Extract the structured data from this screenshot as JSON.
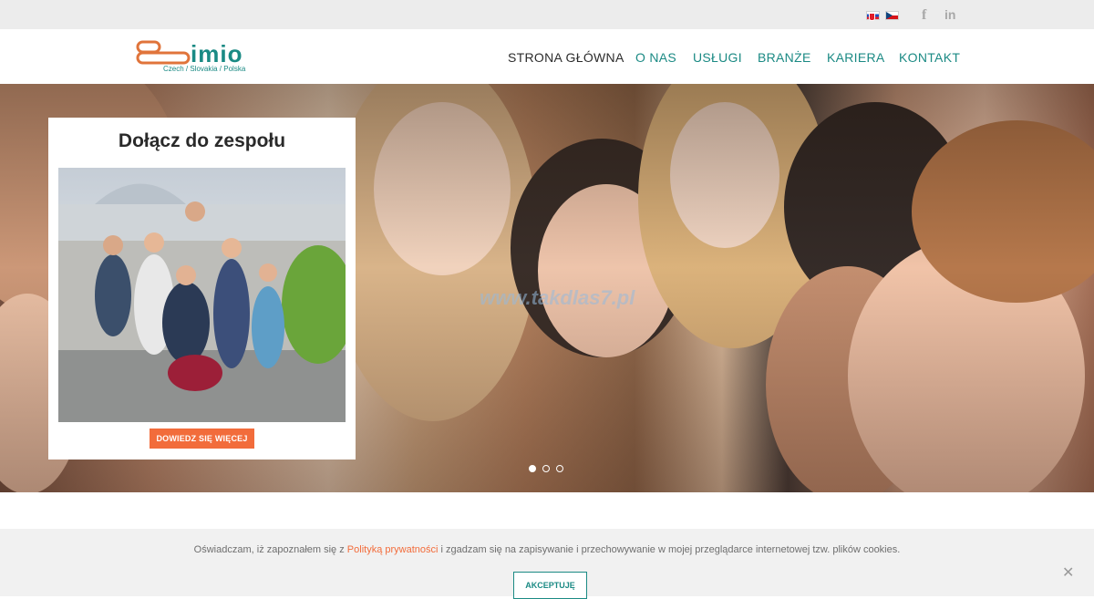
{
  "topbar": {
    "flags": [
      {
        "name": "slovakia-flag-icon"
      },
      {
        "name": "czech-flag-icon"
      }
    ],
    "social": {
      "facebook": "f",
      "linkedin": "in"
    }
  },
  "header": {
    "logo": {
      "word": "imio",
      "tagline": "Czech / Slovakia / Polska",
      "brand_teal": "#1a8a84",
      "brand_orange": "#e0743b"
    },
    "nav": [
      {
        "label": "STRONA GŁÓWNA",
        "active": true
      },
      {
        "label": "O NAS",
        "active": false
      },
      {
        "label": "USŁUGI",
        "active": false
      },
      {
        "label": "BRANŻE",
        "active": false
      },
      {
        "label": "KARIERA",
        "active": false
      },
      {
        "label": "KONTAKT",
        "active": false
      }
    ]
  },
  "hero": {
    "watermark": "www.takdlas7.pl",
    "slider": {
      "total": 3,
      "active_index": 0
    },
    "card": {
      "title": "Dołącz do zespołu",
      "button": "DOWIEDZ SIĘ WIĘCEJ"
    }
  },
  "cookie": {
    "text_before": "Oświadczam, iż zapoznałem się z ",
    "link": "Polityką prywatności",
    "text_after": " i zgadzam się na zapisywanie i przechowywanie w mojej przeglądarce internetowej tzw. plików cookies.",
    "accept": "AKCEPTUJĘ",
    "close_icon": "close-icon"
  },
  "colors": {
    "accent_orange": "#f26c3b",
    "nav_teal": "#1b8a84"
  }
}
